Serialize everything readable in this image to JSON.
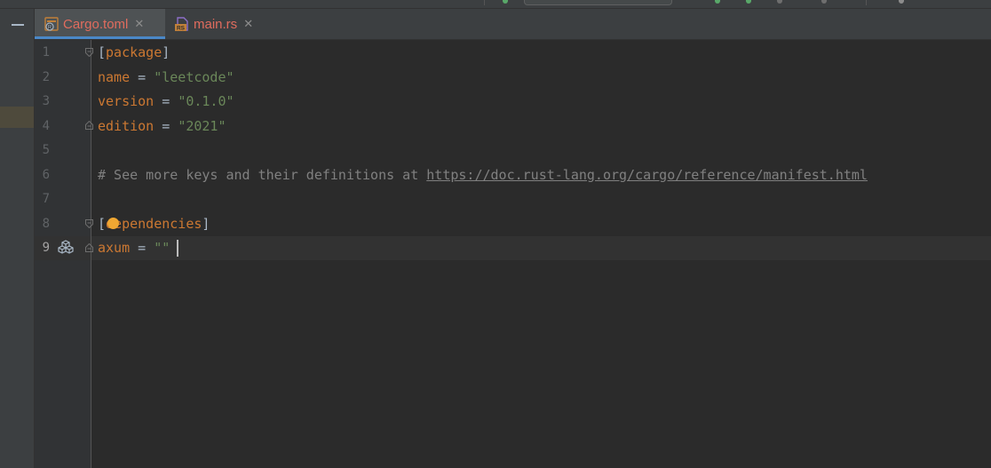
{
  "tabs": [
    {
      "label": "Cargo.toml",
      "icon": "toml-file-icon",
      "active": true
    },
    {
      "label": "main.rs",
      "icon": "rust-file-icon",
      "active": false
    }
  ],
  "lines": [
    {
      "number": "1",
      "parts": [
        {
          "t": "[",
          "c": "p"
        },
        {
          "t": "package",
          "c": "kw"
        },
        {
          "t": "]",
          "c": "p"
        }
      ]
    },
    {
      "number": "2",
      "parts": [
        {
          "t": "name",
          "c": "kw"
        },
        {
          "t": " = ",
          "c": "p"
        },
        {
          "t": "\"leetcode\"",
          "c": "str"
        }
      ]
    },
    {
      "number": "3",
      "parts": [
        {
          "t": "version",
          "c": "kw"
        },
        {
          "t": " = ",
          "c": "p"
        },
        {
          "t": "\"0.1.0\"",
          "c": "str"
        }
      ]
    },
    {
      "number": "4",
      "parts": [
        {
          "t": "edition",
          "c": "kw"
        },
        {
          "t": " = ",
          "c": "p"
        },
        {
          "t": "\"2021\"",
          "c": "str"
        }
      ]
    },
    {
      "number": "5",
      "parts": []
    },
    {
      "number": "6",
      "parts": [
        {
          "t": "# See more keys and their definitions at ",
          "c": "cm"
        },
        {
          "t": "https://doc.rust-lang.org/cargo/reference/manifest.html",
          "c": "url"
        }
      ]
    },
    {
      "number": "7",
      "parts": []
    },
    {
      "number": "8",
      "parts": [
        {
          "t": "[",
          "c": "p"
        },
        {
          "t": "dependencies",
          "c": "kw"
        },
        {
          "t": "]",
          "c": "p"
        }
      ]
    },
    {
      "number": "9",
      "parts": [
        {
          "t": "axum",
          "c": "kw"
        },
        {
          "t": " = ",
          "c": "p"
        },
        {
          "t": "\"\"",
          "c": "str"
        }
      ]
    }
  ],
  "current_line": "9",
  "icons": {
    "gutter_line9": "crate-icon",
    "line8": "lightbulb-icon",
    "sidebar": "minimize-icon"
  },
  "colors": {
    "keyword": "#cc7832",
    "string": "#6a8759",
    "comment": "#808080",
    "tab_accent": "#4a88c7",
    "bulb": "#f0a732"
  }
}
